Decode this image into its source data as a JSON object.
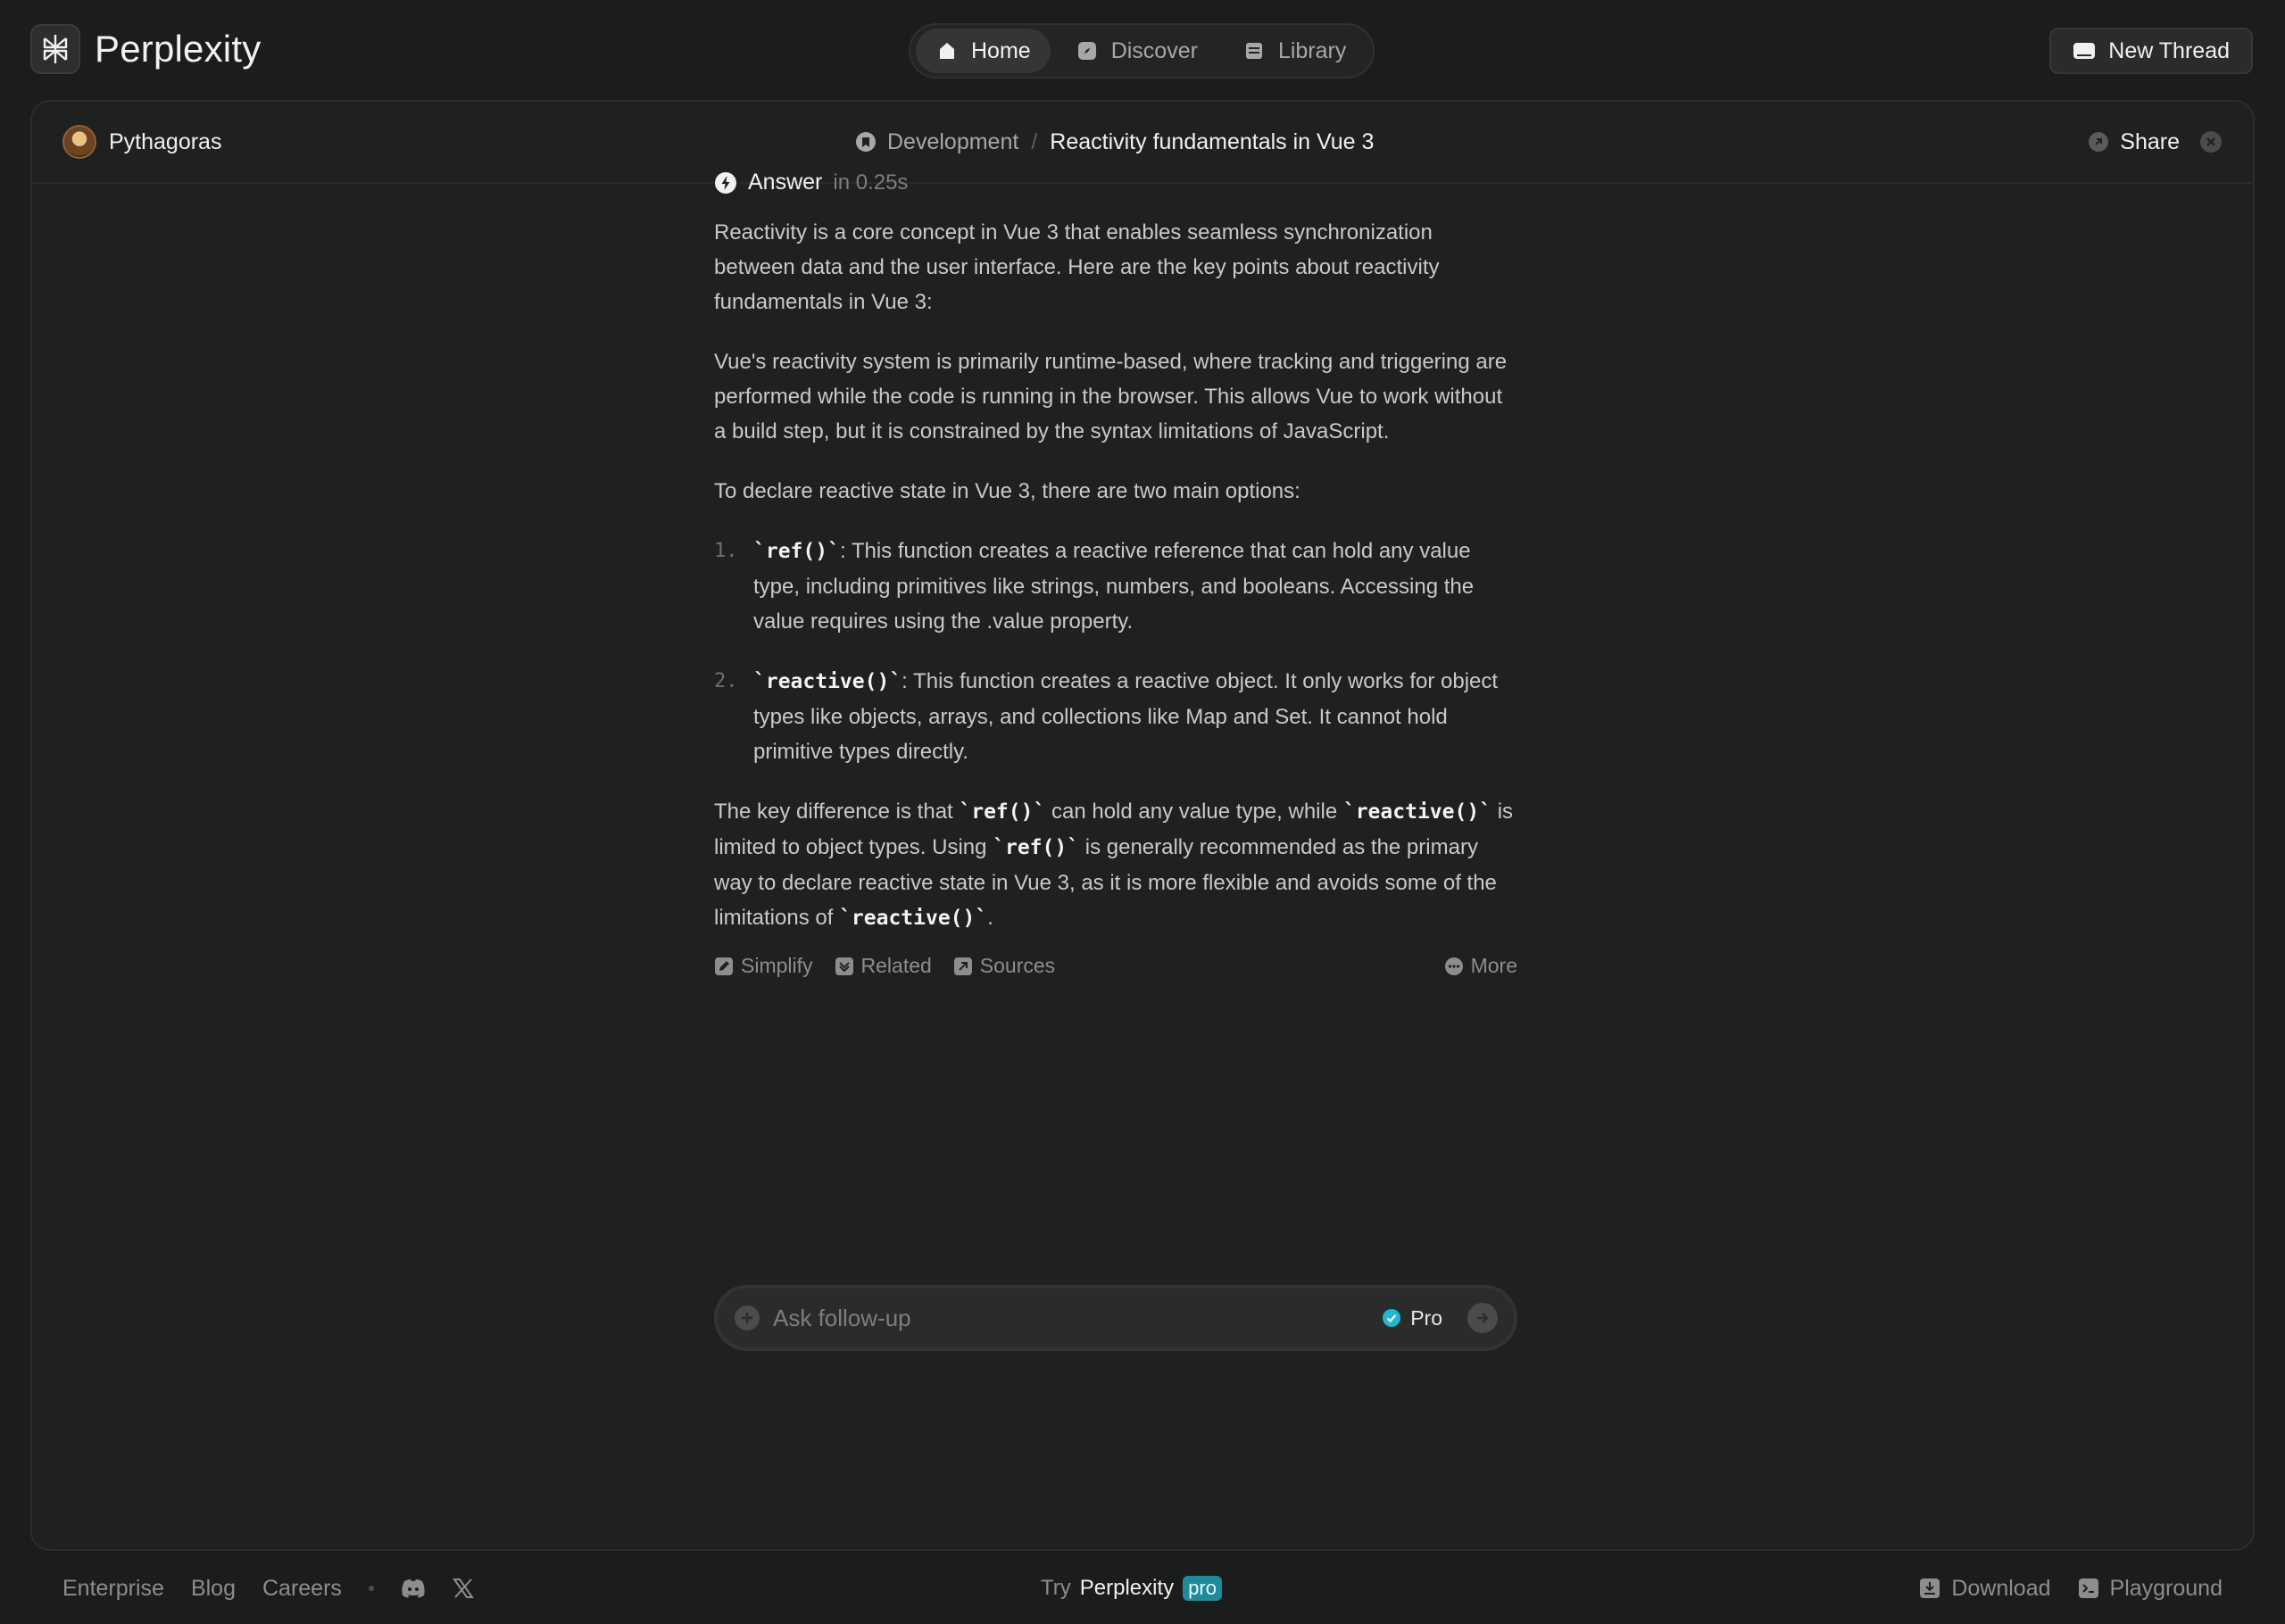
{
  "app": {
    "brand": "Perplexity"
  },
  "nav": [
    {
      "label": "Home",
      "icon": "home-icon",
      "active": true
    },
    {
      "label": "Discover",
      "icon": "compass-icon",
      "active": false
    },
    {
      "label": "Library",
      "icon": "library-icon",
      "active": false
    }
  ],
  "new_thread_label": "New Thread",
  "thread": {
    "author": "Pythagoras",
    "space": "Development",
    "separator": "/",
    "title": "Reactivity fundamentals in Vue 3",
    "share_label": "Share"
  },
  "answer": {
    "label": "Answer",
    "time": "in 0.25s",
    "p1": "Reactivity is a core concept in Vue 3 that enables seamless synchronization between data and the user interface. Here are the key points about reactivity fundamentals in Vue 3:",
    "p2": "Vue's reactivity system is primarily runtime-based, where tracking and triggering are performed while the code is running in the browser. This allows Vue to work without a build step, but it is constrained by the syntax limitations of JavaScript.",
    "p3": "To declare reactive state in Vue 3, there are two main options:",
    "list": [
      {
        "num": "1.",
        "code": "`ref()`",
        "text": ": This function creates a reactive reference that can hold any value type, including primitives like strings, numbers, and booleans. Accessing the value requires using the .value property."
      },
      {
        "num": "2.",
        "code": "`reactive()`",
        "text": ": This function creates a reactive object. It only works for object types like objects, arrays, and collections like Map and Set. It cannot hold primitive types directly."
      }
    ],
    "p4": {
      "t1": "The key difference is that ",
      "c1": "`ref()`",
      "t2": " can hold any value type, while ",
      "c2": "`reactive()`",
      "t3": " is limited to object types. Using ",
      "c3": "`ref()`",
      "t4": " is generally recommended as the primary way to declare reactive state in Vue 3, as it is more flexible and avoids some of the limitations of ",
      "c4": "`reactive()`",
      "t5": "."
    },
    "actions": {
      "simplify": "Simplify",
      "related": "Related",
      "sources": "Sources",
      "more": "More"
    }
  },
  "followup": {
    "placeholder": "Ask follow-up",
    "pro_label": "Pro"
  },
  "footer": {
    "enterprise": "Enterprise",
    "blog": "Blog",
    "careers": "Careers",
    "try": "Try",
    "brand": "Perplexity",
    "pro_badge": "pro",
    "download": "Download",
    "playground": "Playground"
  },
  "colors": {
    "background": "#1b1c1c",
    "panel": "#1f2020",
    "accent": "#20b8cd"
  }
}
